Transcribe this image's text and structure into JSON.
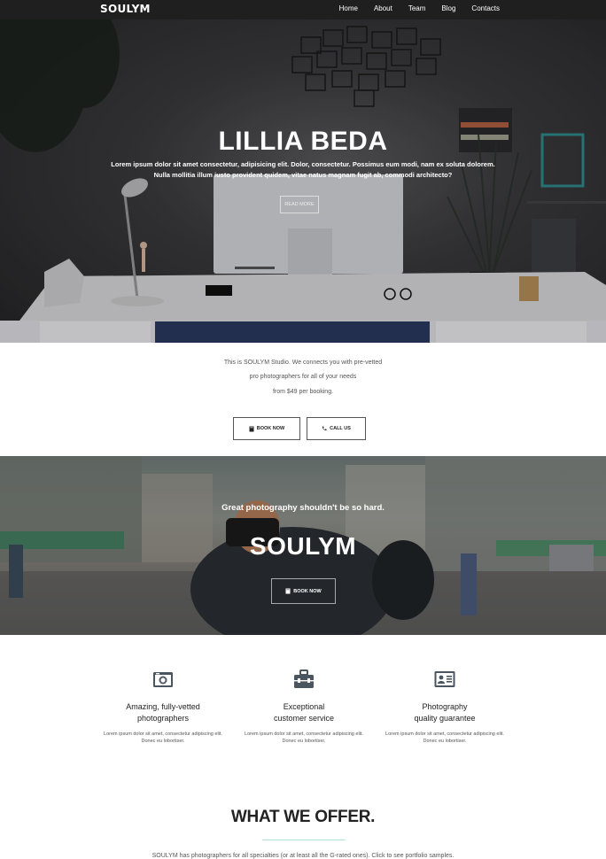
{
  "nav": {
    "brand": "SOULYM",
    "items": [
      "Home",
      "About",
      "Team",
      "Blog",
      "Contacts"
    ]
  },
  "hero": {
    "title": "LILLIA BEDA",
    "text_line1": "Lorem ipsum dolor sit amet consectetur, adipisicing elit. Dolor, consectetur. Possimus eum modi, nam ex soluta dolorem.",
    "text_line2": "Nulla mollitia illum iusto provident quidem, vitae natus magnam fugit ab, commodi architecto?",
    "button": "READ MORE"
  },
  "intro": {
    "line1": "This is SOULYM Studio. We connects you with pre-vetted",
    "line2": "pro photographers for all of your needs",
    "line3": "from $49 per booking.",
    "book_button": "BOOK NOW",
    "call_button": "CALL US"
  },
  "banner": {
    "subtitle": "Great photography shouldn't be so hard.",
    "title": "SOULYM",
    "button": "BOOK NOW"
  },
  "features": [
    {
      "icon": "camera-icon",
      "title_line1": "Amazing, fully-vetted",
      "title_line2": "photographers",
      "text_line1": "Lorem ipsum dolor sit amet, consectetur adipiscing elit.",
      "text_line2": "Donec eu lobortiser."
    },
    {
      "icon": "toolbox-icon",
      "title_line1": "Exceptional",
      "title_line2": "customer service",
      "text_line1": "Lorem ipsum dolor sit amet, consectetur adipiscing elit.",
      "text_line2": "Donec eu lobortiser."
    },
    {
      "icon": "id-card-icon",
      "title_line1": "Photography",
      "title_line2": "quality guarantee",
      "text_line1": "Lorem ipsum dolor sit amet, consectetur adipiscing elit.",
      "text_line2": "Donec eu lobortiser."
    }
  ],
  "offer": {
    "title": "WHAT WE OFFER.",
    "text": "SOULYM has photographers for all specialties (or at least all the G-rated ones). Click to see portfolio samples."
  },
  "colors": {
    "nav_bg": "#1f1f1f",
    "accent_line": "#aee3e0",
    "icon_color": "#4a5560"
  }
}
